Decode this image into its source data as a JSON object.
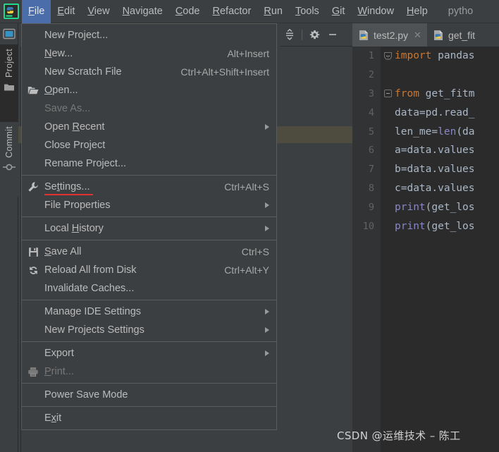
{
  "window": {
    "title_fragment": "pytho"
  },
  "menubar": {
    "logo_icon": "pycharm-logo-icon",
    "items": [
      {
        "label": "File",
        "mnemonic": "F",
        "active": true
      },
      {
        "label": "Edit",
        "mnemonic": "E",
        "active": false
      },
      {
        "label": "View",
        "mnemonic": "V",
        "active": false
      },
      {
        "label": "Navigate",
        "mnemonic": "N",
        "active": false
      },
      {
        "label": "Code",
        "mnemonic": "C",
        "active": false
      },
      {
        "label": "Refactor",
        "mnemonic": "R",
        "active": false
      },
      {
        "label": "Run",
        "mnemonic": "R",
        "active": false
      },
      {
        "label": "Tools",
        "mnemonic": "T",
        "active": false
      },
      {
        "label": "Git",
        "mnemonic": "G",
        "active": false
      },
      {
        "label": "Window",
        "mnemonic": "W",
        "active": false
      },
      {
        "label": "Help",
        "mnemonic": "H",
        "active": false
      }
    ]
  },
  "file_menu": {
    "items": [
      {
        "label": "New Project...",
        "shortcut": "",
        "icon": "",
        "arrow": false,
        "disabled": false,
        "sep_after": false
      },
      {
        "label": "New...",
        "mn": "N",
        "shortcut": "Alt+Insert",
        "icon": "",
        "arrow": false,
        "disabled": false,
        "sep_after": false
      },
      {
        "label": "New Scratch File",
        "shortcut": "Ctrl+Alt+Shift+Insert",
        "icon": "",
        "arrow": false,
        "disabled": false,
        "sep_after": false
      },
      {
        "label": "Open...",
        "mn": "O",
        "shortcut": "",
        "icon": "folder-open-icon",
        "arrow": false,
        "disabled": false,
        "sep_after": false
      },
      {
        "label": "Save As...",
        "shortcut": "",
        "icon": "",
        "arrow": false,
        "disabled": true,
        "sep_after": false
      },
      {
        "label": "Open Recent",
        "mn": "R",
        "shortcut": "",
        "icon": "",
        "arrow": true,
        "disabled": false,
        "sep_after": false
      },
      {
        "label": "Close Project",
        "shortcut": "",
        "icon": "",
        "arrow": false,
        "disabled": false,
        "sep_after": false
      },
      {
        "label": "Rename Project...",
        "shortcut": "",
        "icon": "",
        "arrow": false,
        "disabled": false,
        "sep_after": true
      },
      {
        "label": "Settings...",
        "mn": "t",
        "shortcut": "Ctrl+Alt+S",
        "icon": "wrench-icon",
        "arrow": false,
        "disabled": false,
        "sep_after": false,
        "highlighted": true
      },
      {
        "label": "File Properties",
        "shortcut": "",
        "icon": "",
        "arrow": true,
        "disabled": false,
        "sep_after": true
      },
      {
        "label": "Local History",
        "mn": "H",
        "shortcut": "",
        "icon": "",
        "arrow": true,
        "disabled": false,
        "sep_after": true
      },
      {
        "label": "Save All",
        "mn": "S",
        "shortcut": "Ctrl+S",
        "icon": "save-icon",
        "arrow": false,
        "disabled": false,
        "sep_after": false
      },
      {
        "label": "Reload All from Disk",
        "shortcut": "Ctrl+Alt+Y",
        "icon": "reload-icon",
        "arrow": false,
        "disabled": false,
        "sep_after": false
      },
      {
        "label": "Invalidate Caches...",
        "shortcut": "",
        "icon": "",
        "arrow": false,
        "disabled": false,
        "sep_after": true
      },
      {
        "label": "Manage IDE Settings",
        "shortcut": "",
        "icon": "",
        "arrow": true,
        "disabled": false,
        "sep_after": false
      },
      {
        "label": "New Projects Settings",
        "shortcut": "",
        "icon": "",
        "arrow": true,
        "disabled": false,
        "sep_after": true
      },
      {
        "label": "Export",
        "shortcut": "",
        "icon": "",
        "arrow": true,
        "disabled": false,
        "sep_after": false
      },
      {
        "label": "Print...",
        "mn": "P",
        "shortcut": "",
        "icon": "print-icon",
        "arrow": false,
        "disabled": true,
        "sep_after": true
      },
      {
        "label": "Power Save Mode",
        "shortcut": "",
        "icon": "",
        "arrow": false,
        "disabled": false,
        "sep_after": true
      },
      {
        "label": "Exit",
        "mn": "x",
        "shortcut": "",
        "icon": "",
        "arrow": false,
        "disabled": false,
        "sep_after": false
      }
    ]
  },
  "toolstrip": {
    "top_button_icon": "tool-window-icon",
    "tabs": [
      {
        "label": "Project",
        "icon": "folder-icon",
        "active": true
      },
      {
        "label": "Commit",
        "icon": "commit-node-icon",
        "active": false
      }
    ]
  },
  "tool_header": {
    "collapse_all_icon": "collapse-all-icon",
    "settings_icon": "gear-icon",
    "hide_icon": "minimize-icon"
  },
  "editor": {
    "tabs": [
      {
        "label": "test2.py",
        "icon": "python-file-icon",
        "active": true,
        "closable": true
      },
      {
        "label": "get_fit",
        "icon": "python-file-icon",
        "active": false,
        "closable": false
      }
    ],
    "lines": [
      {
        "no": "1",
        "fold": "top",
        "tokens": [
          {
            "t": "import",
            "c": "kw"
          },
          {
            "t": " pandas",
            "c": "ident"
          }
        ]
      },
      {
        "no": "2",
        "fold": "bar",
        "tokens": []
      },
      {
        "no": "3",
        "fold": "mid",
        "tokens": [
          {
            "t": "from",
            "c": "kw"
          },
          {
            "t": " get_fitm",
            "c": "ident"
          }
        ]
      },
      {
        "no": "4",
        "fold": "",
        "tokens": [
          {
            "t": "data=pd.read_",
            "c": "code"
          }
        ]
      },
      {
        "no": "5",
        "fold": "",
        "tokens": [
          {
            "t": "len_me=",
            "c": "code"
          },
          {
            "t": "len",
            "c": "builtin"
          },
          {
            "t": "(da",
            "c": "code"
          }
        ]
      },
      {
        "no": "6",
        "fold": "",
        "tokens": [
          {
            "t": "a=data.values",
            "c": "code"
          }
        ]
      },
      {
        "no": "7",
        "fold": "",
        "tokens": [
          {
            "t": "b=data.values",
            "c": "code"
          }
        ]
      },
      {
        "no": "8",
        "fold": "",
        "tokens": [
          {
            "t": "c=data.values",
            "c": "code"
          }
        ]
      },
      {
        "no": "9",
        "fold": "",
        "tokens": [
          {
            "t": "print",
            "c": "builtin"
          },
          {
            "t": "(get_los",
            "c": "code"
          }
        ]
      },
      {
        "no": "10",
        "fold": "",
        "tokens": [
          {
            "t": "print",
            "c": "builtin"
          },
          {
            "t": "(get_los",
            "c": "code"
          }
        ]
      }
    ]
  },
  "watermark": {
    "text": "CSDN @运维技术 – 陈工"
  },
  "colors": {
    "background": "#3C3F41",
    "editor_background": "#2B2B2B",
    "menu_highlight": "#4B6EAB",
    "accent_red": "#E03030",
    "selection_row": "#4E4B3F",
    "keyword_orange": "#CC7832",
    "identifier": "#A9B7C6",
    "function_purple": "#8888C6"
  }
}
